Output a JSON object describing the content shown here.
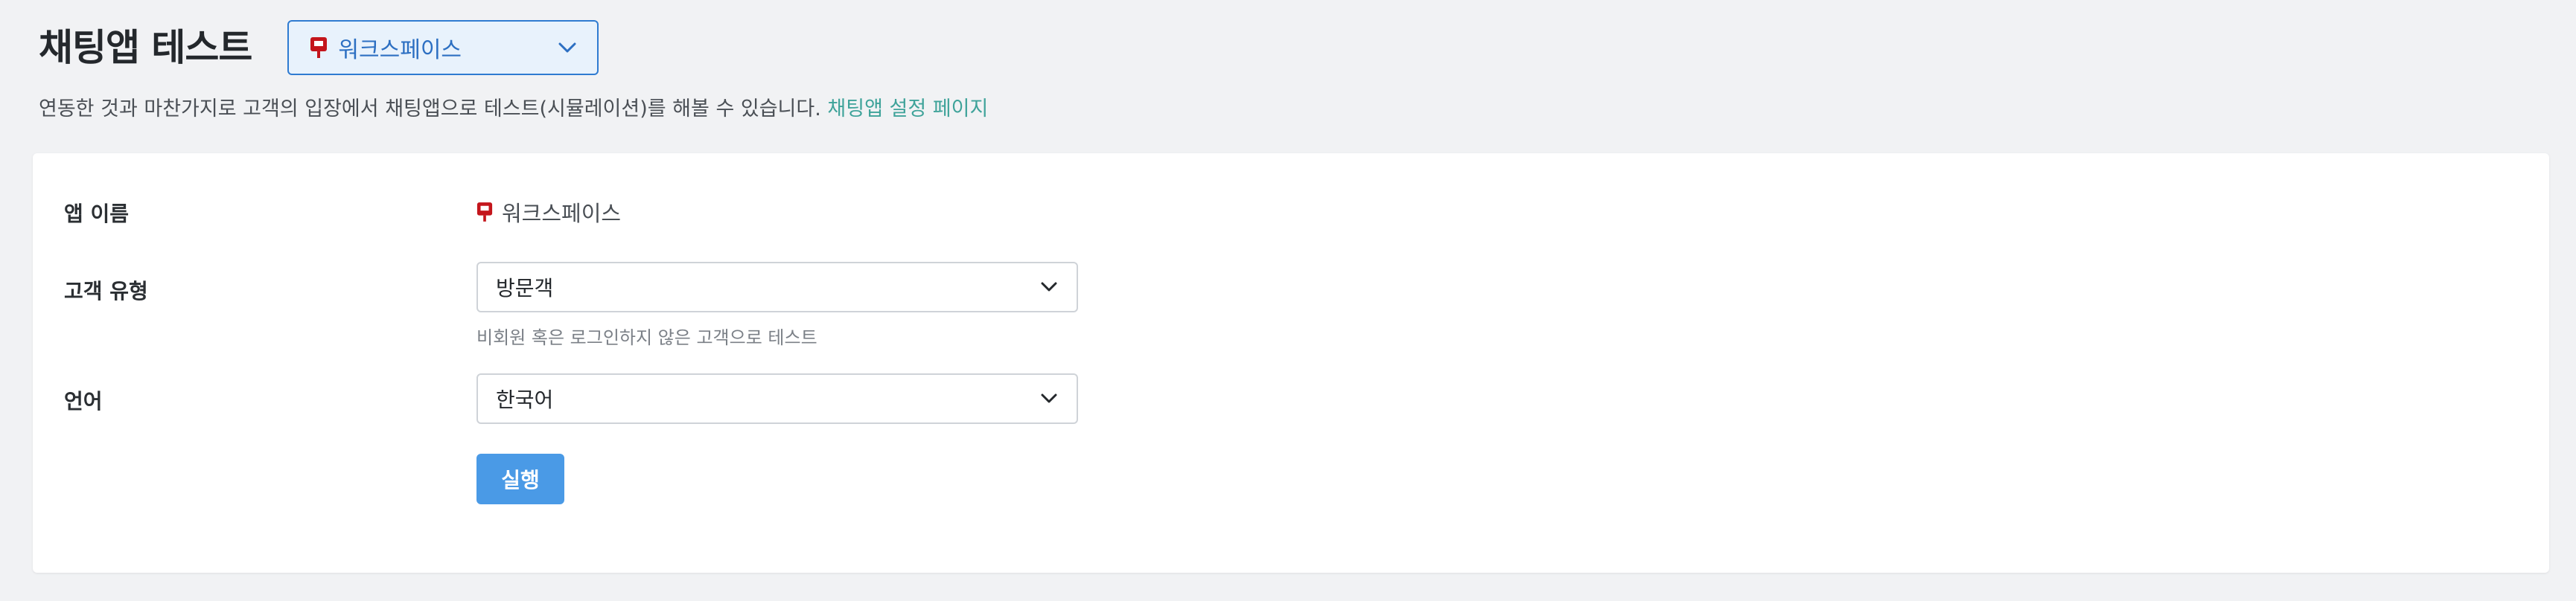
{
  "page": {
    "title": "채팅앱 테스트",
    "description": "연동한 것과 마찬가지로 고객의 입장에서 채팅앱으로 테스트(시뮬레이션)를 해볼 수 있습니다.",
    "settings_link": "채팅앱 설정 페이지"
  },
  "workspace_select": {
    "value": "워크스페이스",
    "icon": "workspace-logo-icon",
    "chevron_icon": "chevron-down-icon"
  },
  "form": {
    "app_name": {
      "label": "앱 이름",
      "value": "워크스페이스",
      "icon": "workspace-logo-icon"
    },
    "customer_type": {
      "label": "고객 유형",
      "value": "방문객",
      "hint": "비회원 혹은 로그인하지 않은 고객으로 테스트"
    },
    "language": {
      "label": "언어",
      "value": "한국어"
    },
    "run_label": "실행"
  },
  "colors": {
    "background": "#f1f2f4",
    "accent": "#2f7bd1",
    "button": "#4a9ae6",
    "link": "#3fa39a",
    "logo_red": "#c4161c"
  }
}
